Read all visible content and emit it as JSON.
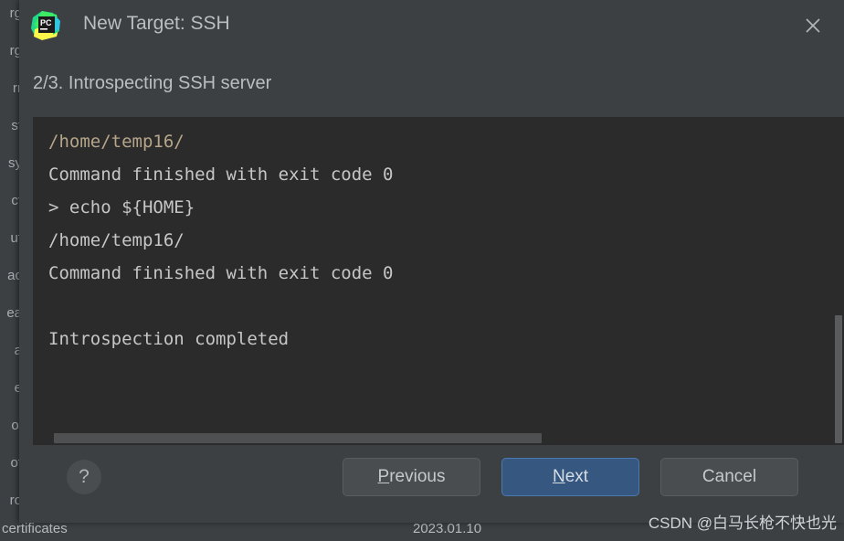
{
  "dialog": {
    "title": "New Target: SSH",
    "app_icon": "pycharm-icon",
    "close_icon": "close-icon",
    "step_label": "2/3. Introspecting SSH server"
  },
  "console": {
    "clipped_top_line": "/home/temp16/",
    "lines": [
      "Command finished with exit code 0",
      "> echo ${HOME}",
      "/home/temp16/",
      "Command finished with exit code 0",
      "",
      "Introspection completed"
    ],
    "vertical_scrollbar": "vertical-scrollbar",
    "horizontal_scrollbar": "horizontal-scrollbar"
  },
  "footer": {
    "help_label": "?",
    "buttons": [
      {
        "label": "Previous",
        "mnemonic": "P",
        "style": "secondary"
      },
      {
        "label": "Next",
        "mnemonic": "N",
        "style": "primary"
      },
      {
        "label": "Cancel",
        "mnemonic": "",
        "style": "secondary"
      }
    ]
  },
  "background": {
    "left_rows": [
      "rg",
      "rg",
      "rr",
      "st",
      "sy",
      "ct",
      "ut",
      "ac",
      "ea",
      "a",
      "e",
      "ol",
      "ot",
      "ro"
    ],
    "bottom_label": "certificates",
    "bottom_date": "2023.01.10"
  },
  "watermark": {
    "text": "CSDN @白马长枪不快也光"
  },
  "colors": {
    "dialog_background": "#3c4043",
    "console_background": "#2b2b2b",
    "primary_button": "#365880",
    "secondary_button": "#4a4d50",
    "text": "#b9bec1",
    "console_text": "#c6c6c6"
  }
}
